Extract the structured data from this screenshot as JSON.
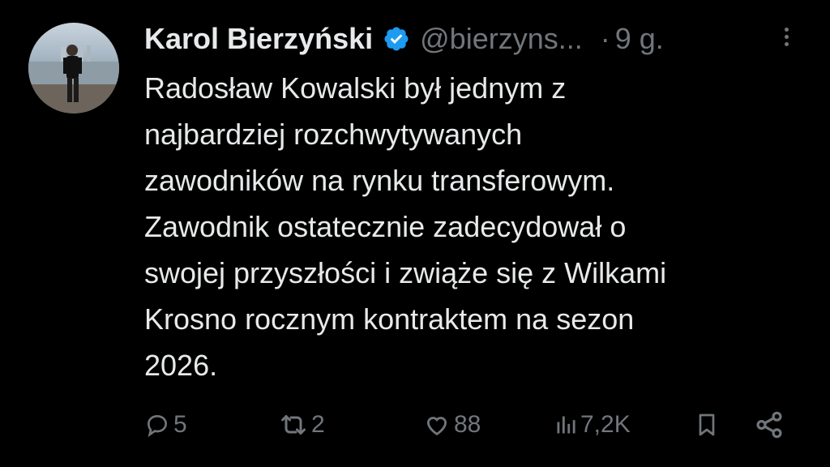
{
  "tweet": {
    "author_name": "Karol Bierzyński",
    "handle": "@bierzyns...",
    "separator": "·",
    "time": "9 g.",
    "text": "Radosław Kowalski był jednym z\nnajbardziej rozchwytywanych\nzawodników na rynku transferowym.\nZawodnik ostatecznie zadecydował o\nswojej przyszłości i zwiąże się z Wilkami\nKrosno rocznym kontraktem na sezon\n2026.",
    "verified": true
  },
  "actions": {
    "replies": "5",
    "reposts": "2",
    "likes": "88",
    "views": "7,2K"
  },
  "icons": [
    "reply-icon",
    "repost-icon",
    "like-icon",
    "views-icon",
    "bookmark-icon",
    "share-icon",
    "more-icon",
    "verified-badge-icon"
  ],
  "colors": {
    "background": "#000000",
    "text": "#e7e9ea",
    "muted": "#71767b",
    "verified": "#1d9bf0"
  }
}
